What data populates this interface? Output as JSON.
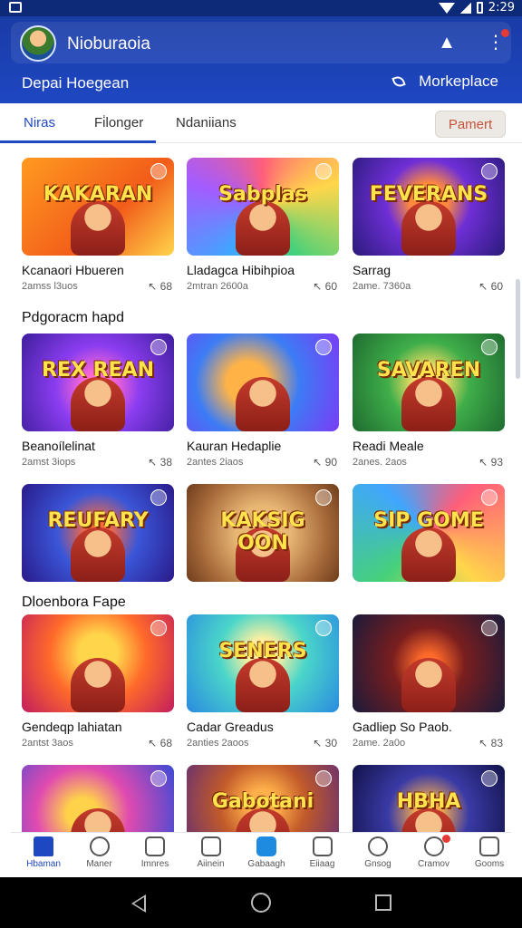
{
  "status": {
    "time": "2:29"
  },
  "header": {
    "app_title": "Nioburaoia",
    "department": "Depai Hoegean",
    "marketplace": "Morkeplace"
  },
  "tabs": [
    {
      "label": "Niras",
      "active": true
    },
    {
      "label": "Fi̇longer",
      "active": false
    },
    {
      "label": "Ndaniians",
      "active": false
    }
  ],
  "payment_button": "Pamert",
  "sections": [
    {
      "title": "Pdgoracm hapd"
    },
    {
      "title": "Dloenbora Fape"
    }
  ],
  "cards": [
    {
      "title": "Kcanaori Hbueren",
      "meta": "2amss l3uos",
      "count": "68",
      "logo": "KAKARAN",
      "theme": "orange"
    },
    {
      "title": "Lladagca Hibihpioa",
      "meta": "2mtran 2600a",
      "count": "60",
      "logo": "Sabplas",
      "theme": "rainbow"
    },
    {
      "title": "Sarrag",
      "meta": "2ame. 7360a",
      "count": "60",
      "logo": "FEVERANS",
      "theme": "purple"
    },
    {
      "title": "Beanoílelinat",
      "meta": "2amst 3iops",
      "count": "38",
      "logo": "REX REAN",
      "theme": "violet"
    },
    {
      "title": "Kauran Hedaplie",
      "meta": "2antes 2iaos",
      "count": "90",
      "logo": "",
      "theme": "blue"
    },
    {
      "title": "Readi Meale",
      "meta": "2anes. 2aos",
      "count": "93",
      "logo": "SAVAREN",
      "theme": "green"
    },
    {
      "title": "",
      "meta": "",
      "count": "",
      "logo": "REUFARY",
      "theme": "blue2"
    },
    {
      "title": "",
      "meta": "",
      "count": "",
      "logo": "KAKSIG OON",
      "theme": "brown"
    },
    {
      "title": "",
      "meta": "",
      "count": "",
      "logo": "SIP GOME",
      "theme": "rainbow2"
    },
    {
      "title": "Gendeqp lahiatan",
      "meta": "2antst 3aos",
      "count": "68",
      "logo": "",
      "theme": "sunset"
    },
    {
      "title": "Cadar Greadus",
      "meta": "2anties 2aoos",
      "count": "30",
      "logo": "SENERS",
      "theme": "teal"
    },
    {
      "title": "Gadliep So Paob.",
      "meta": "2ame. 2a0o",
      "count": "83",
      "logo": "",
      "theme": "dark"
    },
    {
      "title": "",
      "meta": "",
      "count": "",
      "logo": "",
      "theme": "pinkblue"
    },
    {
      "title": "",
      "meta": "",
      "count": "",
      "logo": "Gabotani",
      "theme": "brown2"
    },
    {
      "title": "",
      "meta": "",
      "count": "",
      "logo": "HBHA",
      "theme": "navy"
    }
  ],
  "bottom_nav": [
    {
      "label": "Hbaman",
      "active": true
    },
    {
      "label": "Maner",
      "active": false
    },
    {
      "label": "Imnres",
      "active": false
    },
    {
      "label": "Aiinein",
      "active": false
    },
    {
      "label": "Gabaagh",
      "active": false
    },
    {
      "label": "Eiiaag",
      "active": false
    },
    {
      "label": "Gnsog",
      "active": false
    },
    {
      "label": "Cramov",
      "active": false
    },
    {
      "label": "Gooms",
      "active": false
    }
  ],
  "colors": {
    "brand": "#1e47c2",
    "header": "#1a3ba6",
    "accent_red": "#e53935"
  }
}
